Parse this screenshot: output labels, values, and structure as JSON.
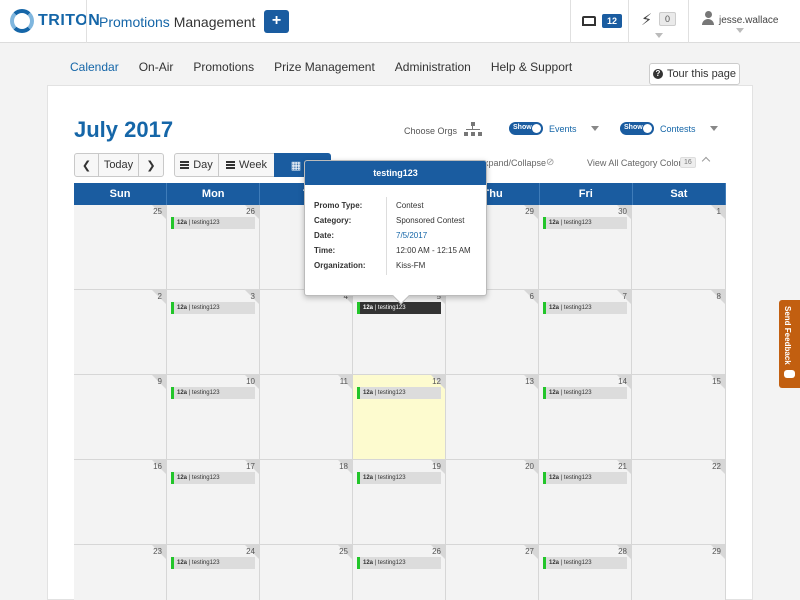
{
  "topbar": {
    "logo_text": "TRITON",
    "app_title_blue": "Promotions",
    "app_title_rest": " Management",
    "plus_label": "+",
    "inbox_count": "12",
    "alerts_count": "0",
    "username": "jesse.wallace"
  },
  "nav": {
    "items": [
      "Calendar",
      "On-Air",
      "Promotions",
      "Prize Management",
      "Administration",
      "Help & Support"
    ],
    "active": "Calendar",
    "tour_label": "Tour this page"
  },
  "toolbar": {
    "month_title": "July 2017",
    "choose_orgs": "Choose Orgs",
    "events_toggle": "Show",
    "events_label": "Events",
    "contests_toggle": "Show",
    "contests_label": "Contests",
    "today_label": "Today",
    "day_label": "Day",
    "week_label": "Week",
    "month_label": "M",
    "expand_label": "xpand/Collapse",
    "view_colors_label": "View All Category Colors",
    "view_colors_count": "16"
  },
  "calendar": {
    "weekdays": [
      "Sun",
      "Mon",
      "T",
      "W",
      "Thu",
      "Fri",
      "Sat"
    ],
    "weeks": [
      [
        "25",
        "26",
        "",
        "",
        "29",
        "30",
        "1"
      ],
      [
        "2",
        "3",
        "4",
        "5",
        "6",
        "7",
        "8"
      ],
      [
        "9",
        "10",
        "11",
        "12",
        "13",
        "14",
        "15"
      ],
      [
        "16",
        "17",
        "18",
        "19",
        "20",
        "21",
        "22"
      ],
      [
        "23",
        "24",
        "25",
        "26",
        "27",
        "28",
        "29"
      ]
    ],
    "event_time": "12a",
    "event_name": "testing123"
  },
  "popover": {
    "title": "testing123",
    "promo_type_label": "Promo Type:",
    "promo_type": "Contest",
    "category_label": "Category:",
    "category": "Sponsored Contest",
    "date_label": "Date:",
    "date": "7/5/2017",
    "time_label": "Time:",
    "time": "12:00 AM - 12:15 AM",
    "organization_label": "Organization:",
    "organization": "Kiss-FM"
  },
  "feedback": {
    "label": "Send Feedback"
  },
  "colors": {
    "brand_blue": "#1a5ca0",
    "event_green": "#22c52a",
    "feedback_orange": "#c25f10",
    "highlight_yellow": "#fdfbcf"
  }
}
